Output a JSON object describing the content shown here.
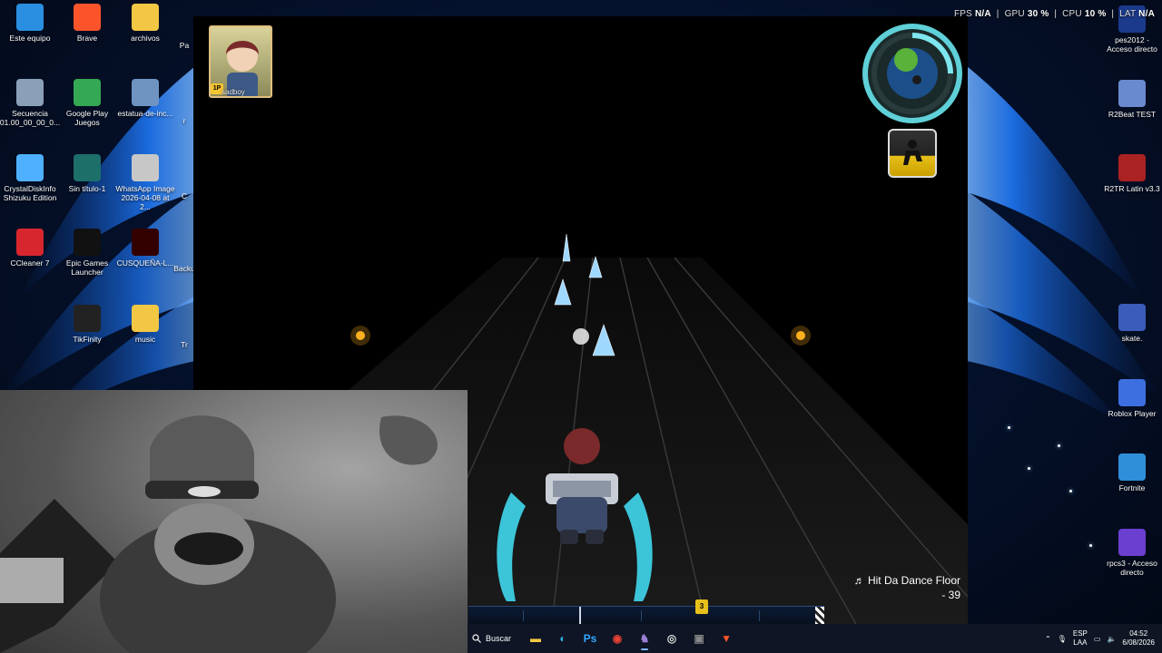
{
  "overlay_stats": {
    "fps_label": "FPS",
    "fps_value": "N/A",
    "gpu_label": "GPU",
    "gpu_value": "30 %",
    "cpu_label": "CPU",
    "cpu_value": "10 %",
    "lat_label": "LAT",
    "lat_value": "N/A"
  },
  "desktop_icons_left": [
    {
      "label": "Este equipo",
      "icon": "pc-icon",
      "color": "#2a8fe0"
    },
    {
      "label": "Brave",
      "icon": "brave-icon",
      "color": "#fb542b"
    },
    {
      "label": "archivos",
      "icon": "folder-icon",
      "color": "#f2c744"
    },
    {
      "label": "Secuencia 01.00_00_00_0...",
      "icon": "image-icon",
      "color": "#8aa0b8"
    },
    {
      "label": "Google Play Juegos",
      "icon": "play-games-icon",
      "color": "#34a853"
    },
    {
      "label": "estatua-de-inc...",
      "icon": "image-icon",
      "color": "#6f94c2"
    },
    {
      "label": "CrystalDiskInfo Shizuku Edition",
      "icon": "disk-icon",
      "color": "#4fb0ff"
    },
    {
      "label": "Sin título-1",
      "icon": "image-icon",
      "color": "#1d6f6a"
    },
    {
      "label": "WhatsApp Image 2026-04-08 at 2...",
      "icon": "image-icon",
      "color": "#c7c7c7"
    },
    {
      "label": "CCleaner 7",
      "icon": "ccleaner-icon",
      "color": "#d8262f"
    },
    {
      "label": "Epic Games Launcher",
      "icon": "epic-icon",
      "color": "#111111"
    },
    {
      "label": "CUSQUEÑA-L...",
      "icon": "illustrator-icon",
      "color": "#330000"
    },
    {
      "label": "TikFinity",
      "icon": "tikfinity-icon",
      "color": "#222222"
    },
    {
      "label": "music",
      "icon": "folder-icon",
      "color": "#f2c744"
    }
  ],
  "desktop_icons_partial": [
    "Pa",
    "r",
    "C",
    "Backu",
    "Tr"
  ],
  "desktop_icons_right": [
    {
      "label": "pes2012 - Acceso directo",
      "icon": "pes-icon",
      "color": "#1b3a8c"
    },
    {
      "label": "R2Beat TEST",
      "icon": "r2beat-icon",
      "color": "#6a8ad0"
    },
    {
      "label": "R2TR Latin v3.3",
      "icon": "r2tr-icon",
      "color": "#a22"
    },
    {
      "label": "skate.",
      "icon": "skate-icon",
      "color": "#3b5cb8"
    },
    {
      "label": "Roblox Player",
      "icon": "roblox-icon",
      "color": "#3d6fe0"
    },
    {
      "label": "Fortnite",
      "icon": "fortnite-icon",
      "color": "#2f8fd9"
    },
    {
      "label": "rpcs3 - Acceso directo",
      "icon": "rpcs3-icon",
      "color": "#6b3fd0"
    }
  ],
  "game": {
    "player_name": "sadboy",
    "player_badge": "1P",
    "song_title": "Hit Da Dance Floor",
    "song_score": "- 39",
    "progress_marker": "3",
    "progress_fraction": 0.32
  },
  "taskbar": {
    "search_label": "Buscar",
    "apps": [
      {
        "name": "file-explorer-icon",
        "color": "#f2c744",
        "glyph": "▬"
      },
      {
        "name": "edge-icon",
        "color": "#2bb0e8",
        "glyph": "◐"
      },
      {
        "name": "photoshop-icon",
        "color": "#31a8ff",
        "glyph": "Ps"
      },
      {
        "name": "chrome-icon",
        "color": "#e94235",
        "glyph": "◉"
      },
      {
        "name": "game-app-icon",
        "color": "#9b7fd6",
        "glyph": "♞"
      },
      {
        "name": "obs-icon",
        "color": "#dddddd",
        "glyph": "◎"
      },
      {
        "name": "terminal-icon",
        "color": "#888888",
        "glyph": "▣"
      },
      {
        "name": "brave-icon",
        "color": "#fb542b",
        "glyph": "▼"
      }
    ],
    "language_line1": "ESP",
    "language_line2": "LAA",
    "clock_time": "04:52",
    "clock_date": "6/08/2026"
  }
}
